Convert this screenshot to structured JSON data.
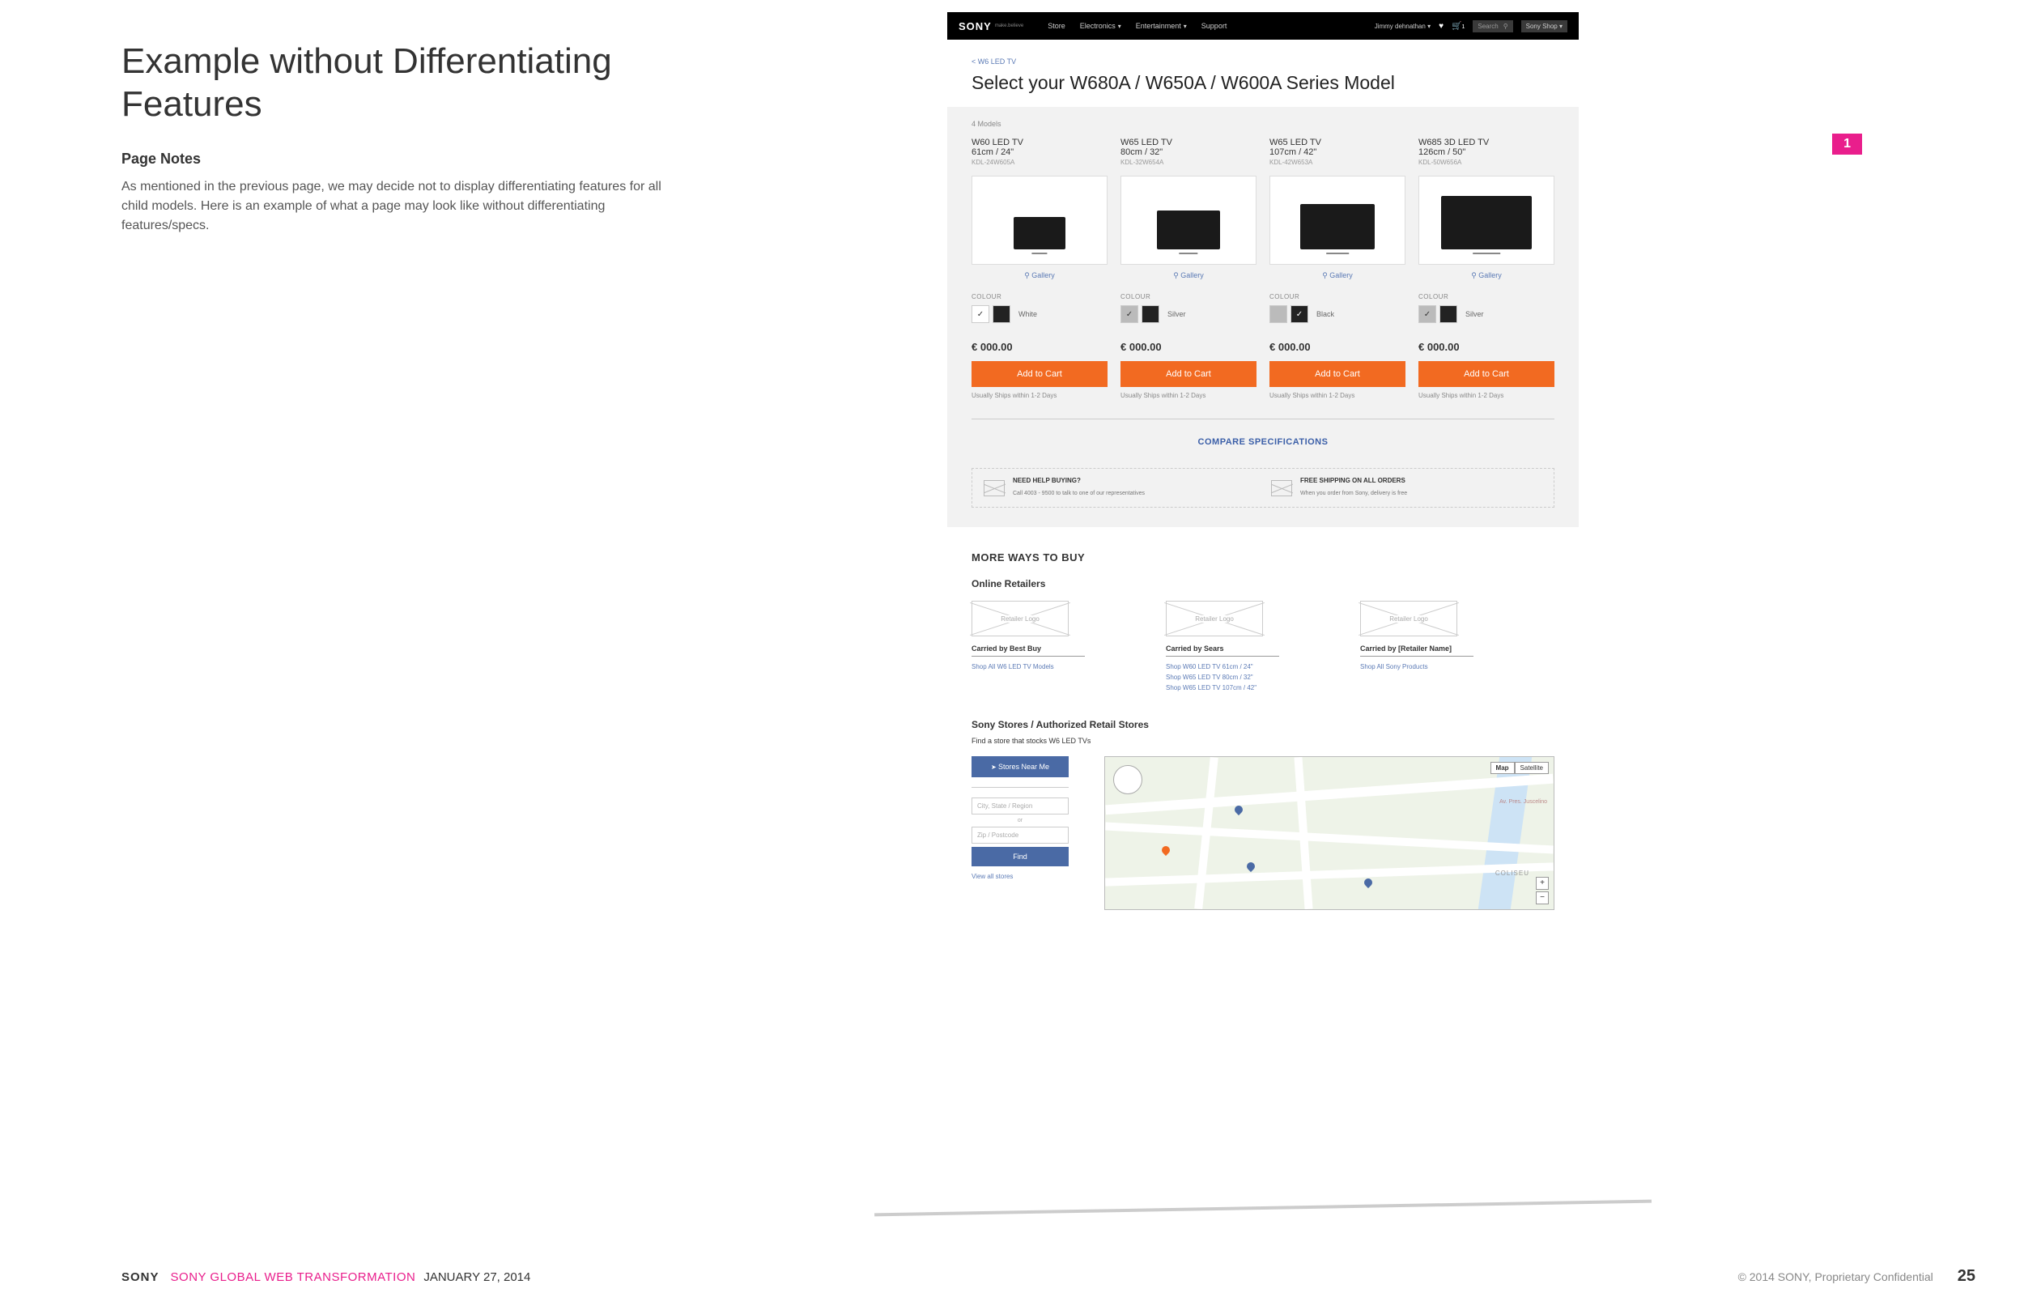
{
  "doc": {
    "title": "Example without Differentiating Features",
    "notes_heading": "Page Notes",
    "notes_body": "As mentioned in the previous page, we may decide not to display differentiating features for all child models.  Here is an example of what a page may look like without differentiating features/specs.",
    "annotation": "1",
    "footer_brand": "SONY",
    "footer_project": "SONY GLOBAL WEB TRANSFORMATION",
    "footer_date": "JANUARY 27, 2014",
    "footer_copyright": "© 2014 SONY, Proprietary  Confidential",
    "footer_page": "25"
  },
  "nav": {
    "brand": "SONY",
    "brand_sub": "make.believe",
    "links": [
      "Store",
      "Electronics",
      "Entertainment",
      "Support"
    ],
    "user": "Jimmy dehnathan",
    "cart_count": "1",
    "search_placeholder": "Search",
    "shop_label": "Sony Shop"
  },
  "page": {
    "breadcrumb": "< W6 LED TV",
    "title": "Select your W680A / W650A / W600A Series Model",
    "count": "4 Models",
    "compare": "COMPARE SPECIFICATIONS",
    "colour_label": "COLOUR",
    "gallery": "Gallery",
    "atc": "Add to Cart",
    "ship": "Usually Ships within 1-2 Days",
    "help": {
      "a_title": "NEED HELP BUYING?",
      "a_body": "Call 4003 - 9500 to talk to one of our representatives",
      "b_title": "FREE SHIPPING ON ALL ORDERS",
      "b_body": "When you order from Sony, delivery is free"
    }
  },
  "products": [
    {
      "name": "W60 LED TV",
      "dim": "61cm / 24\"",
      "sku": "KDL-24W605A",
      "tv_w": 64,
      "tv_h": 40,
      "sw1": "white",
      "sw1_check": true,
      "sw2": "black",
      "txt": "White",
      "price": "€ 000.00"
    },
    {
      "name": "W65 LED TV",
      "dim": "80cm / 32\"",
      "sku": "KDL-32W654A",
      "tv_w": 78,
      "tv_h": 48,
      "sw1": "silver",
      "sw1_check": true,
      "sw2": "black",
      "txt": "Silver",
      "price": "€ 000.00"
    },
    {
      "name": "W65 LED TV",
      "dim": "107cm / 42\"",
      "sku": "KDL-42W653A",
      "tv_w": 92,
      "tv_h": 56,
      "sw1": "silver",
      "sw1_check": false,
      "sw2": "black",
      "sw2_check": true,
      "txt": "Black",
      "price": "€ 000.00"
    },
    {
      "name": "W685 3D LED TV",
      "dim": "126cm / 50\"",
      "sku": "KDL-50W656A",
      "tv_w": 112,
      "tv_h": 66,
      "sw1": "silver",
      "sw1_check": true,
      "sw2": "black",
      "txt": "Silver",
      "price": "€ 000.00"
    }
  ],
  "mwtb": {
    "heading": "MORE WAYS TO BUY",
    "online": "Online Retailers",
    "logo_placeholder": "Retailer Logo",
    "retailers": [
      {
        "carried": "Carried by Best Buy",
        "links": [
          "Shop All W6 LED TV Models"
        ]
      },
      {
        "carried": "Carried by Sears",
        "links": [
          "Shop W60 LED TV 61cm / 24\"",
          "Shop W65 LED TV 80cm / 32\"",
          "Shop W65 LED TV 107cm / 42\""
        ]
      },
      {
        "carried": "Carried by [Retailer Name]",
        "links": [
          "Shop All Sony Products"
        ]
      }
    ],
    "stores_h": "Sony Stores / Authorized Retail Stores",
    "stores_sub": "Find a store that stocks W6 LED TVs",
    "near": "Stores Near Me",
    "city_ph": "City, State / Region",
    "or": "or",
    "zip_ph": "Zip / Postcode",
    "find": "Find",
    "view_all": "View all stores",
    "map": {
      "btn_map": "Map",
      "btn_sat": "Satellite",
      "plus": "+",
      "minus": "−",
      "area": "COLISEU",
      "road": "Av. Pres. Juscelino"
    }
  }
}
